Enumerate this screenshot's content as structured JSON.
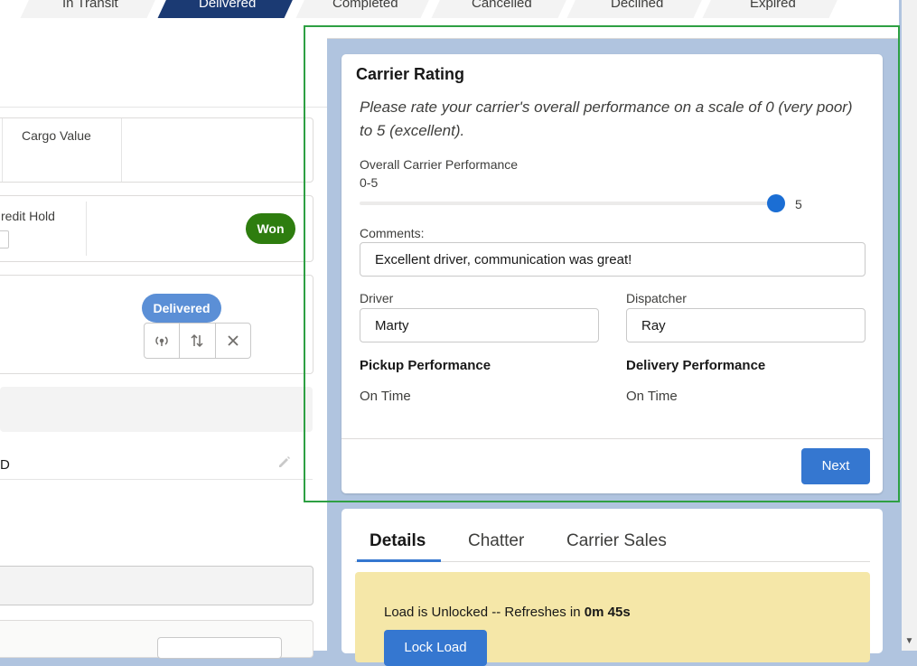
{
  "path_steps": [
    {
      "label": "In Transit",
      "current": false
    },
    {
      "label": "Delivered",
      "current": true
    },
    {
      "label": "Completed",
      "current": false
    },
    {
      "label": "Cancelled",
      "current": false
    },
    {
      "label": "Declined",
      "current": false
    },
    {
      "label": "Expired",
      "current": false
    }
  ],
  "left": {
    "cargo_value_label": "Cargo Value",
    "credit_hold_label": "redit Hold",
    "won_badge": "Won",
    "delivered_badge": "Delivered",
    "partial_field_value": "D"
  },
  "carrier_rating": {
    "title": "Carrier Rating",
    "intro": "Please rate your carrier's overall performance on a scale of 0 (very poor) to 5 (excellent).",
    "performance_label": "Overall Carrier Performance",
    "range_label": "0-5",
    "slider_value": "5",
    "comments_label": "Comments:",
    "comments_value": "Excellent driver, communication was great!",
    "driver_label": "Driver",
    "driver_value": "Marty",
    "dispatcher_label": "Dispatcher",
    "dispatcher_value": "Ray",
    "pickup_label": "Pickup Performance",
    "pickup_value": "On Time",
    "delivery_label": "Delivery Performance",
    "delivery_value": "On Time",
    "next_label": "Next"
  },
  "details": {
    "tabs": [
      "Details",
      "Chatter",
      "Carrier Sales"
    ],
    "notice_text": "Load is Unlocked -- Refreshes in ",
    "notice_time": "0m 45s",
    "lock_button": "Lock Load"
  },
  "colors": {
    "primary": "#3577d0",
    "won": "#2e7d0f",
    "current_step": "#1b3a73",
    "highlight": "#2ea043"
  }
}
